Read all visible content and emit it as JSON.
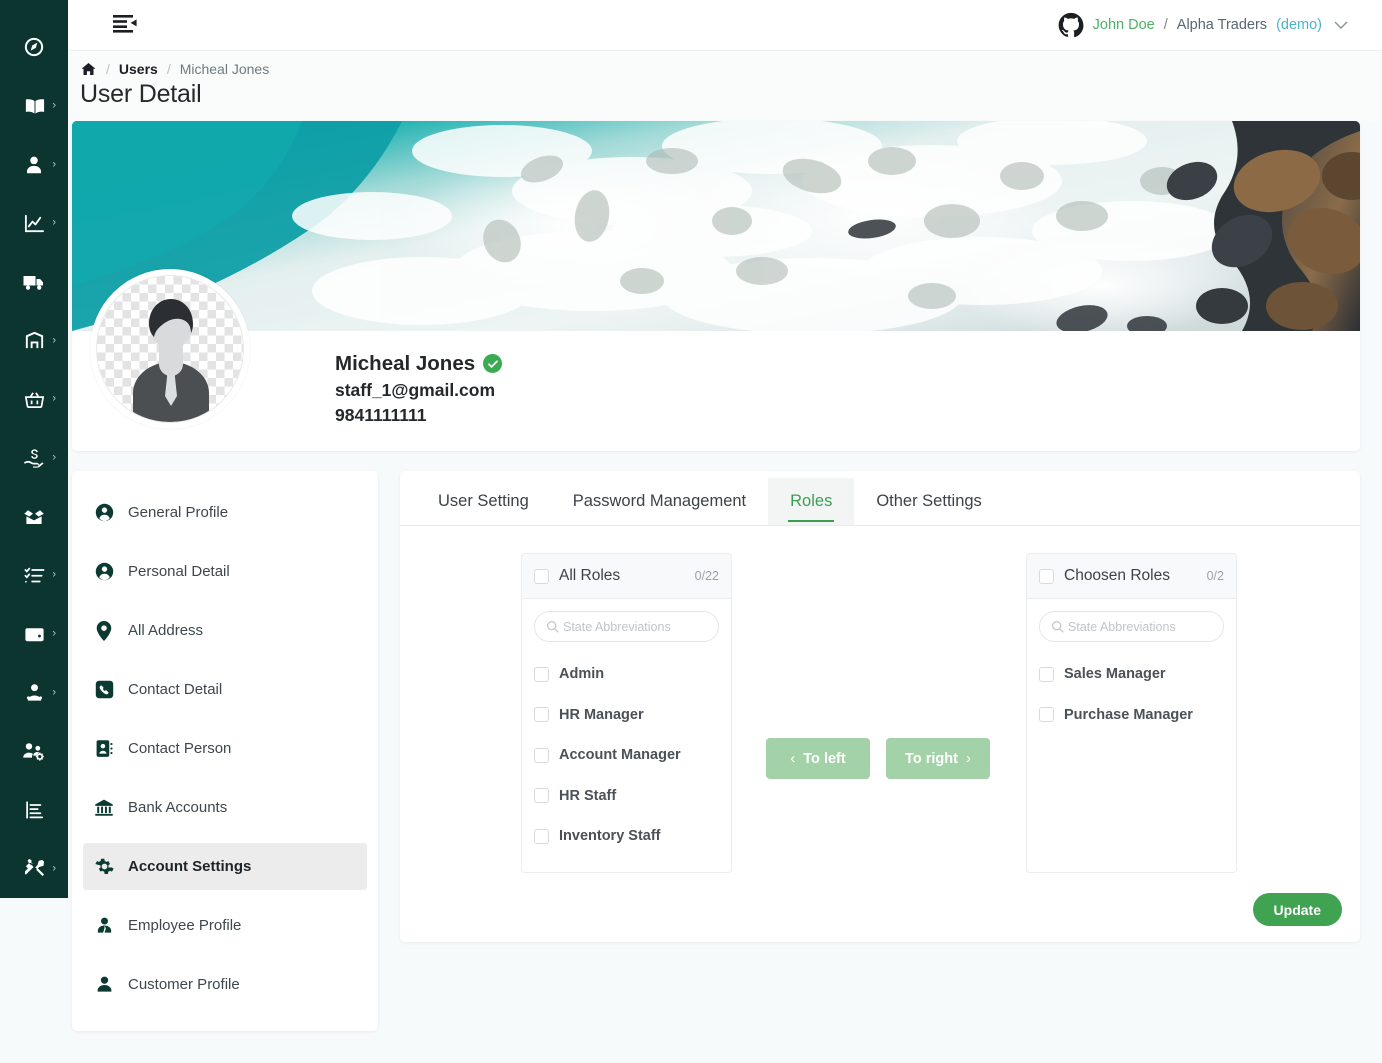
{
  "topbar": {
    "menu_toggle_label": "",
    "github_icon": "github-icon",
    "user_name": "John Doe",
    "separator": "/",
    "org_name": "Alpha Traders",
    "demo_tag": "(demo)",
    "chevron": "∨"
  },
  "breadcrumb": {
    "home_label": "Home",
    "divider": "/",
    "items": [
      {
        "label": "Users",
        "current": false
      },
      {
        "label": "Micheal Jones",
        "current": true
      }
    ]
  },
  "page": {
    "title": "User Detail"
  },
  "profile": {
    "name": "Micheal Jones",
    "verified": true,
    "email": "staff_1@gmail.com",
    "phone": "9841111111",
    "cover_alt": "aerial-ocean-shore-photo",
    "avatar_alt": "default-user-avatar"
  },
  "side_menu": {
    "items": [
      {
        "label": "General Profile",
        "icon": "user-circle-icon",
        "active": false
      },
      {
        "label": "Personal Detail",
        "icon": "user-circle-icon",
        "active": false
      },
      {
        "label": "All Address",
        "icon": "map-pin-icon",
        "active": false
      },
      {
        "label": "Contact Detail",
        "icon": "phone-square-icon",
        "active": false
      },
      {
        "label": "Contact Person",
        "icon": "address-book-icon",
        "active": false
      },
      {
        "label": "Bank Accounts",
        "icon": "bank-icon",
        "active": false
      },
      {
        "label": "Account Settings",
        "icon": "gear-icon",
        "active": true
      },
      {
        "label": "Employee Profile",
        "icon": "employee-tie-icon",
        "active": false
      },
      {
        "label": "Customer Profile",
        "icon": "user-solid-icon",
        "active": false
      }
    ]
  },
  "rail": {
    "items": [
      {
        "icon": "dashboard-icon",
        "caret": false
      },
      {
        "icon": "book-open-icon",
        "caret": true
      },
      {
        "icon": "user-icon",
        "caret": true
      },
      {
        "icon": "chart-line-icon",
        "caret": true
      },
      {
        "icon": "truck-icon",
        "caret": false
      },
      {
        "icon": "warehouse-icon",
        "caret": true
      },
      {
        "icon": "basket-icon",
        "caret": true
      },
      {
        "icon": "hand-money-icon",
        "caret": true
      },
      {
        "icon": "box-open-icon",
        "caret": false
      },
      {
        "icon": "task-list-icon",
        "caret": true
      },
      {
        "icon": "wallet-icon",
        "caret": true
      },
      {
        "icon": "user-group-icon",
        "caret": true
      },
      {
        "icon": "users-cog-icon",
        "caret": false
      },
      {
        "icon": "report-icon",
        "caret": false
      },
      {
        "icon": "tools-icon",
        "caret": true
      }
    ]
  },
  "tabs": [
    {
      "label": "User Setting",
      "active": false
    },
    {
      "label": "Password Management",
      "active": false
    },
    {
      "label": "Roles",
      "active": true
    },
    {
      "label": "Other Settings",
      "active": false
    }
  ],
  "transfer": {
    "left": {
      "title": "All Roles",
      "count": "0/22",
      "search_placeholder": "State Abbreviations",
      "search_value": "",
      "items": [
        "Admin",
        "HR Manager",
        "Account Manager",
        "HR Staff",
        "Inventory Staff"
      ]
    },
    "right": {
      "title": "Choosen Roles",
      "count": "0/2",
      "search_placeholder": "State Abbreviations",
      "search_value": "",
      "items": [
        "Sales Manager",
        "Purchase Manager"
      ]
    },
    "to_left_label": "To left",
    "to_right_label": "To right",
    "to_left_arrow": "‹",
    "to_right_arrow": "›"
  },
  "actions": {
    "update_label": "Update"
  },
  "colors": {
    "rail_bg": "#0b352e",
    "accent_green": "#3fa352",
    "accent_light_green": "#a3d2a8",
    "tab_active": "#3a9f52",
    "link_blue": "#4db5c9"
  }
}
